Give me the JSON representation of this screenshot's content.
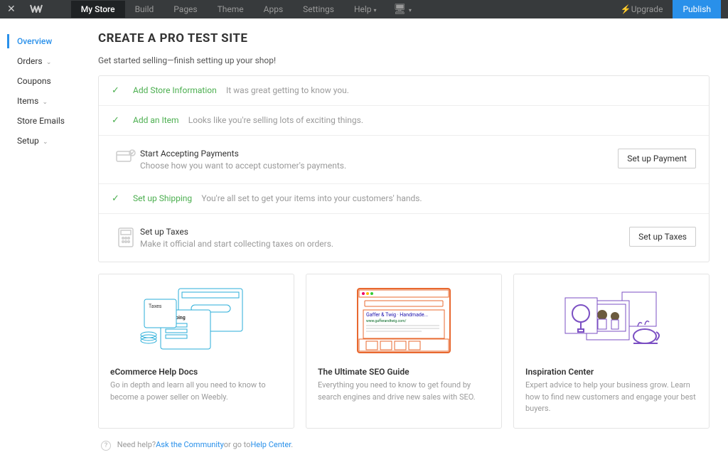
{
  "topbar": {
    "nav": [
      "My Store",
      "Build",
      "Pages",
      "Theme",
      "Apps",
      "Settings",
      "Help"
    ],
    "upgrade": "Upgrade",
    "publish": "Publish"
  },
  "sidebar": {
    "items": [
      {
        "label": "Overview",
        "active": true
      },
      {
        "label": "Orders",
        "sub": true
      },
      {
        "label": "Coupons"
      },
      {
        "label": "Items",
        "sub": true
      },
      {
        "label": "Store Emails"
      },
      {
        "label": "Setup",
        "sub": true
      }
    ]
  },
  "page": {
    "title": "CREATE A PRO TEST SITE",
    "subtitle": "Get started selling—finish setting up your shop!"
  },
  "steps": [
    {
      "done": true,
      "title": "Add Store Information",
      "desc": "It was great getting to know you."
    },
    {
      "done": true,
      "title": "Add an Item",
      "desc": "Looks like you're selling lots of exciting things."
    },
    {
      "done": false,
      "big": true,
      "icon": "card",
      "title": "Start Accepting Payments",
      "desc": "Choose how you want to accept customer's payments.",
      "btn": "Set up Payment"
    },
    {
      "done": true,
      "title": "Set up Shipping",
      "desc": "You're all set to get your items into your customers' hands."
    },
    {
      "done": false,
      "big": true,
      "icon": "calc",
      "title": "Set up Taxes",
      "desc": "Make it official and start collecting taxes on orders.",
      "btn": "Set up Taxes"
    }
  ],
  "cards": [
    {
      "title": "eCommerce Help Docs",
      "desc": "Go in depth and learn all you need to know to become a power seller on Weebly."
    },
    {
      "title": "The Ultimate SEO Guide",
      "desc": "Everything you need to know to get found by search engines and drive new sales with SEO."
    },
    {
      "title": "Inspiration Center",
      "desc": "Expert advice to help your business grow. Learn how to find new customers and engage your best buyers."
    }
  ],
  "help": {
    "prefix": "Need help?",
    "link1": "Ask the Community",
    "mid": "or go to",
    "link2": "Help Center",
    "end": "."
  }
}
